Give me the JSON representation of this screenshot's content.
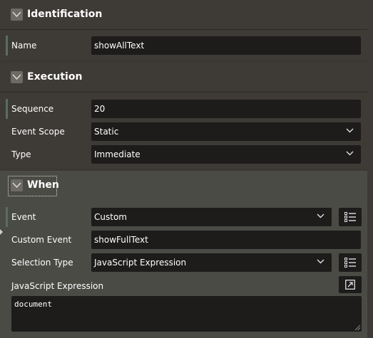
{
  "sections": {
    "identification": {
      "title": "Identification",
      "name_label": "Name",
      "name_value": "showAllText"
    },
    "execution": {
      "title": "Execution",
      "sequence_label": "Sequence",
      "sequence_value": "20",
      "event_scope_label": "Event Scope",
      "event_scope_value": "Static",
      "type_label": "Type",
      "type_value": "Immediate"
    },
    "when": {
      "title": "When",
      "event_label": "Event",
      "event_value": "Custom",
      "custom_event_label": "Custom Event",
      "custom_event_value": "showFullText",
      "selection_type_label": "Selection Type",
      "selection_type_value": "JavaScript Expression",
      "js_expression_label": "JavaScript Expression",
      "js_expression_value": "document"
    }
  },
  "icons": {
    "collapse": "chevron-down-icon",
    "dropdown": "caret-down-icon",
    "list_of_values": "list-icon",
    "expand_editor": "expand-icon"
  },
  "colors": {
    "panel_bg": "#3e3a36",
    "when_bg": "#4a4b45",
    "field_bg": "#1d1c1b",
    "required_marker": "#596e61",
    "chevron_box": "#6d6a66"
  }
}
